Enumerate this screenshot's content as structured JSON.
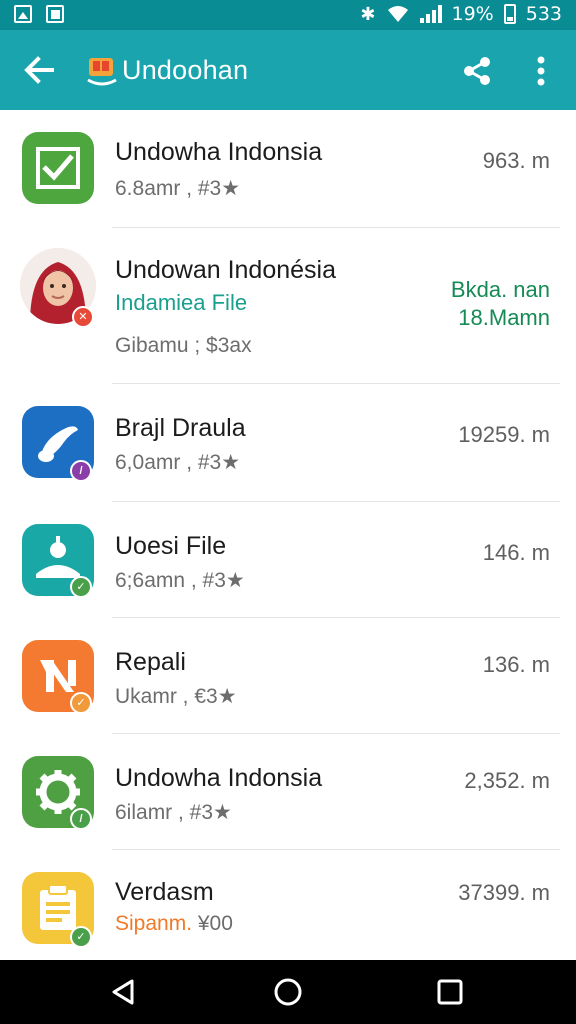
{
  "status_bar": {
    "battery_text": "19%",
    "time": "533"
  },
  "app_bar": {
    "title": "Undoohan",
    "back_icon": "arrow-back-icon",
    "share_icon": "share-icon",
    "more_icon": "more-vert-icon"
  },
  "items": [
    {
      "title": "Undowha Indonsia",
      "subtitle": "6.8amr , #3★",
      "size": "963. m",
      "icon": "checkbox-icon",
      "icon_color": "#4ea63f"
    },
    {
      "title": "Undowan Indonésia",
      "secondary": "Indamiea File",
      "subtitle": "Gibamu ; $3ax",
      "size_line1": "Bkda. nan",
      "size_line2": "18.Mamn",
      "icon": "avatar",
      "badge_color": "#e84a3a"
    },
    {
      "title": "Brajl Draula",
      "subtitle": "6,0amr , #3★",
      "size": "19259. m",
      "icon": "music-note-icon",
      "icon_color": "#1d6fc4",
      "badge_color": "#8b3ea8"
    },
    {
      "title": "Uoesi File",
      "subtitle": "6;6amn , #3★",
      "size": "146. m",
      "icon": "person-icon",
      "icon_color": "#1aa8a6",
      "badge_color": "#4aa04a"
    },
    {
      "title": "Repali",
      "subtitle": "Ukamr , €3★",
      "size": "136. m",
      "icon": "n-logo-icon",
      "icon_color": "#f47a31",
      "badge_color": "#f09a3a"
    },
    {
      "title": "Undowha Indonsia",
      "subtitle": "6ilamr , #3★",
      "size": "2,352. m",
      "icon": "gear-icon",
      "icon_color": "#4fa043",
      "badge_color": "#4aa04a"
    },
    {
      "title": "Verdasm",
      "subtitle_orange": "Sipanm. ",
      "subtitle_rest": "¥00",
      "size": "37399. m",
      "icon": "clipboard-icon",
      "icon_color": "#f4c63a",
      "badge_color": "#4aa04a"
    }
  ],
  "nav_bar": {
    "back_icon": "nav-back-icon",
    "home_icon": "nav-home-icon",
    "recents_icon": "nav-recents-icon"
  }
}
